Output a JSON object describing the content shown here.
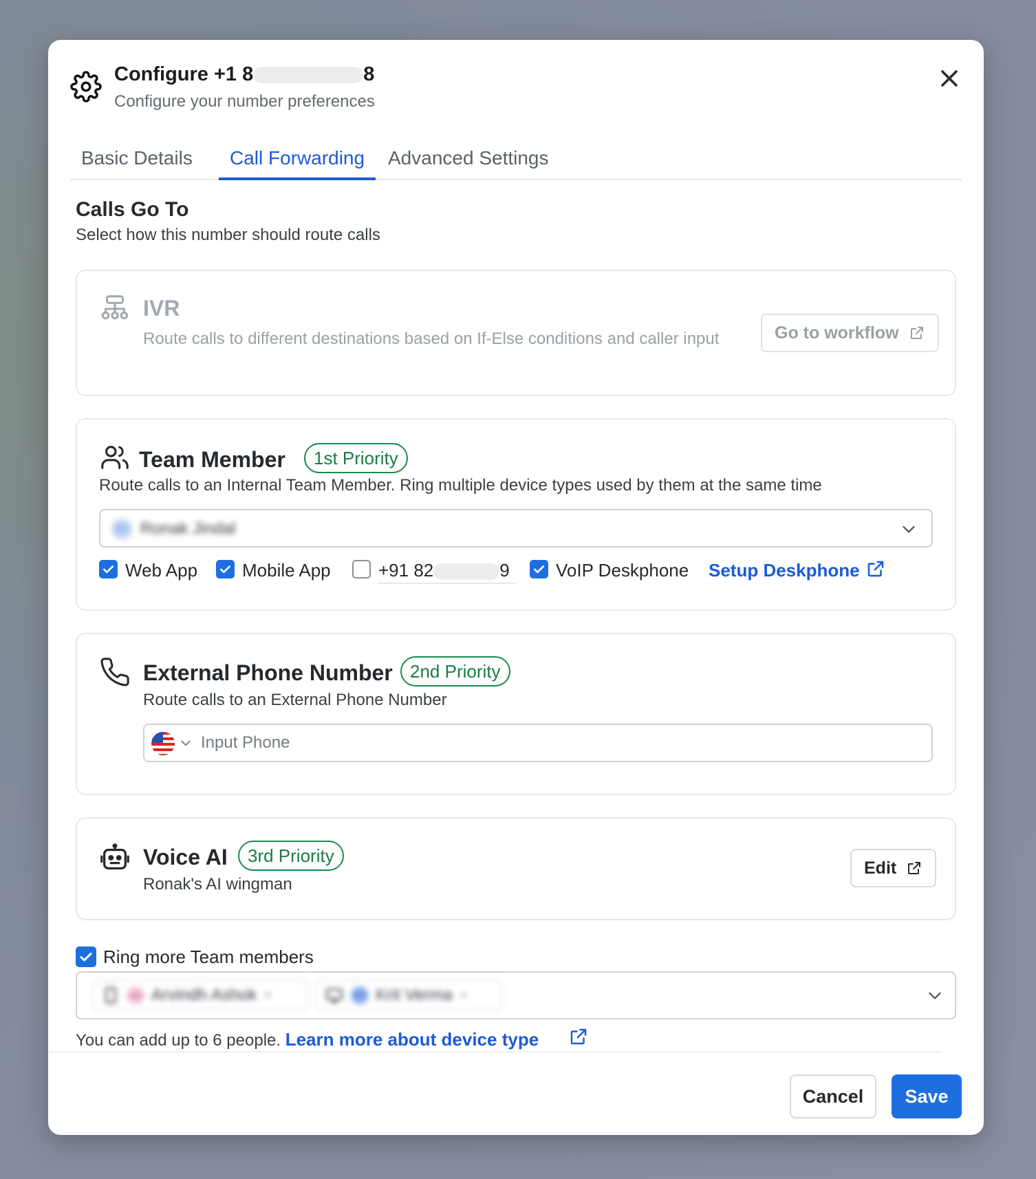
{
  "header": {
    "title_prefix": "Configure +1 8",
    "title_suffix": "8",
    "subtitle": "Configure your number preferences"
  },
  "tabs": [
    {
      "label": "Basic Details"
    },
    {
      "label": "Call Forwarding"
    },
    {
      "label": "Advanced Settings"
    }
  ],
  "active_tab": "Call Forwarding",
  "section": {
    "title": "Calls Go To",
    "subtitle": "Select how this number should route calls"
  },
  "ivr": {
    "title": "IVR",
    "description": "Route calls to different destinations based on If-Else conditions and caller input",
    "button_label": "Go to workflow",
    "enabled": false
  },
  "team_member": {
    "title": "Team Member",
    "priority": "1st Priority",
    "description": "Route calls to an Internal Team Member. Ring multiple device types used by them at the same time",
    "selected_member": "Ronak Jindal",
    "avatar_initials": "RJ",
    "devices": [
      {
        "label": "Web App",
        "checked": true
      },
      {
        "label": "Mobile App",
        "checked": true
      },
      {
        "label": "+91 82",
        "suffix": "9",
        "checked": false
      },
      {
        "label": "VoIP Deskphone",
        "checked": true
      }
    ],
    "setup_link": "Setup Deskphone"
  },
  "external_phone": {
    "title": "External Phone Number",
    "priority": "2nd Priority",
    "description": "Route calls to an External Phone Number",
    "input_placeholder": "Input Phone",
    "country_flag": "US"
  },
  "voice_ai": {
    "title": "Voice AI",
    "priority": "3rd Priority",
    "description": "Ronak's AI wingman",
    "button_label": "Edit"
  },
  "ring_more": {
    "label": "Ring more Team members",
    "checked": true,
    "members": [
      {
        "name": "Arvindh Ashok",
        "device": "mobile",
        "initials": "AA",
        "avatar_color": "#f3c6d8"
      },
      {
        "name": "Krit Verma",
        "device": "desktop",
        "initials": "KV",
        "avatar_color": "#8fb0f0"
      }
    ],
    "helper_text": "You can add up to 6 people.",
    "helper_link": "Learn more about device type"
  },
  "footer": {
    "cancel_label": "Cancel",
    "save_label": "Save"
  },
  "colors": {
    "accent": "#1d6fe0",
    "link": "#1d5bd6",
    "priority_green": "#1a7d43"
  }
}
